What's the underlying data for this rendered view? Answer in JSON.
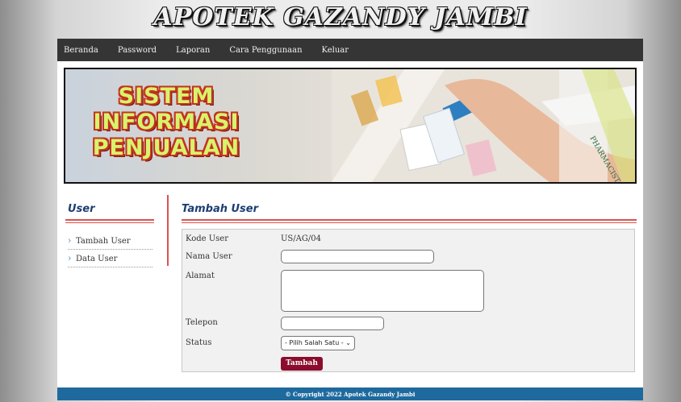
{
  "site": {
    "title": "APOTEK GAZANDY JAMBI"
  },
  "nav": {
    "items": [
      "Beranda",
      "Password",
      "Laporan",
      "Cara Penggunaan",
      "Keluar"
    ]
  },
  "banner": {
    "lines": [
      "SISTEM",
      "INFORMASI",
      "PENJUALAN"
    ],
    "shelf_label": "PHARMACIST"
  },
  "sidebar": {
    "title": "User",
    "items": [
      "Tambah User",
      "Data User"
    ]
  },
  "main": {
    "title": "Tambah User",
    "form": {
      "kode_label": "Kode User",
      "kode_value": "US/AG/04",
      "nama_label": "Nama User",
      "nama_value": "",
      "alamat_label": "Alamat",
      "alamat_value": "",
      "telepon_label": "Telepon",
      "telepon_value": "",
      "status_label": "Status",
      "status_selected": "- Pilih Salah Satu -",
      "submit_label": "Tambah"
    }
  },
  "footer": {
    "text": "© Copyright 2022 Apotek Gazandy Jambi"
  },
  "colors": {
    "nav_bg": "#353535",
    "accent_red": "#d9534f",
    "heading_blue": "#1c3e72",
    "button": "#8b0c2c",
    "footer_bg": "#1e6a9e"
  }
}
